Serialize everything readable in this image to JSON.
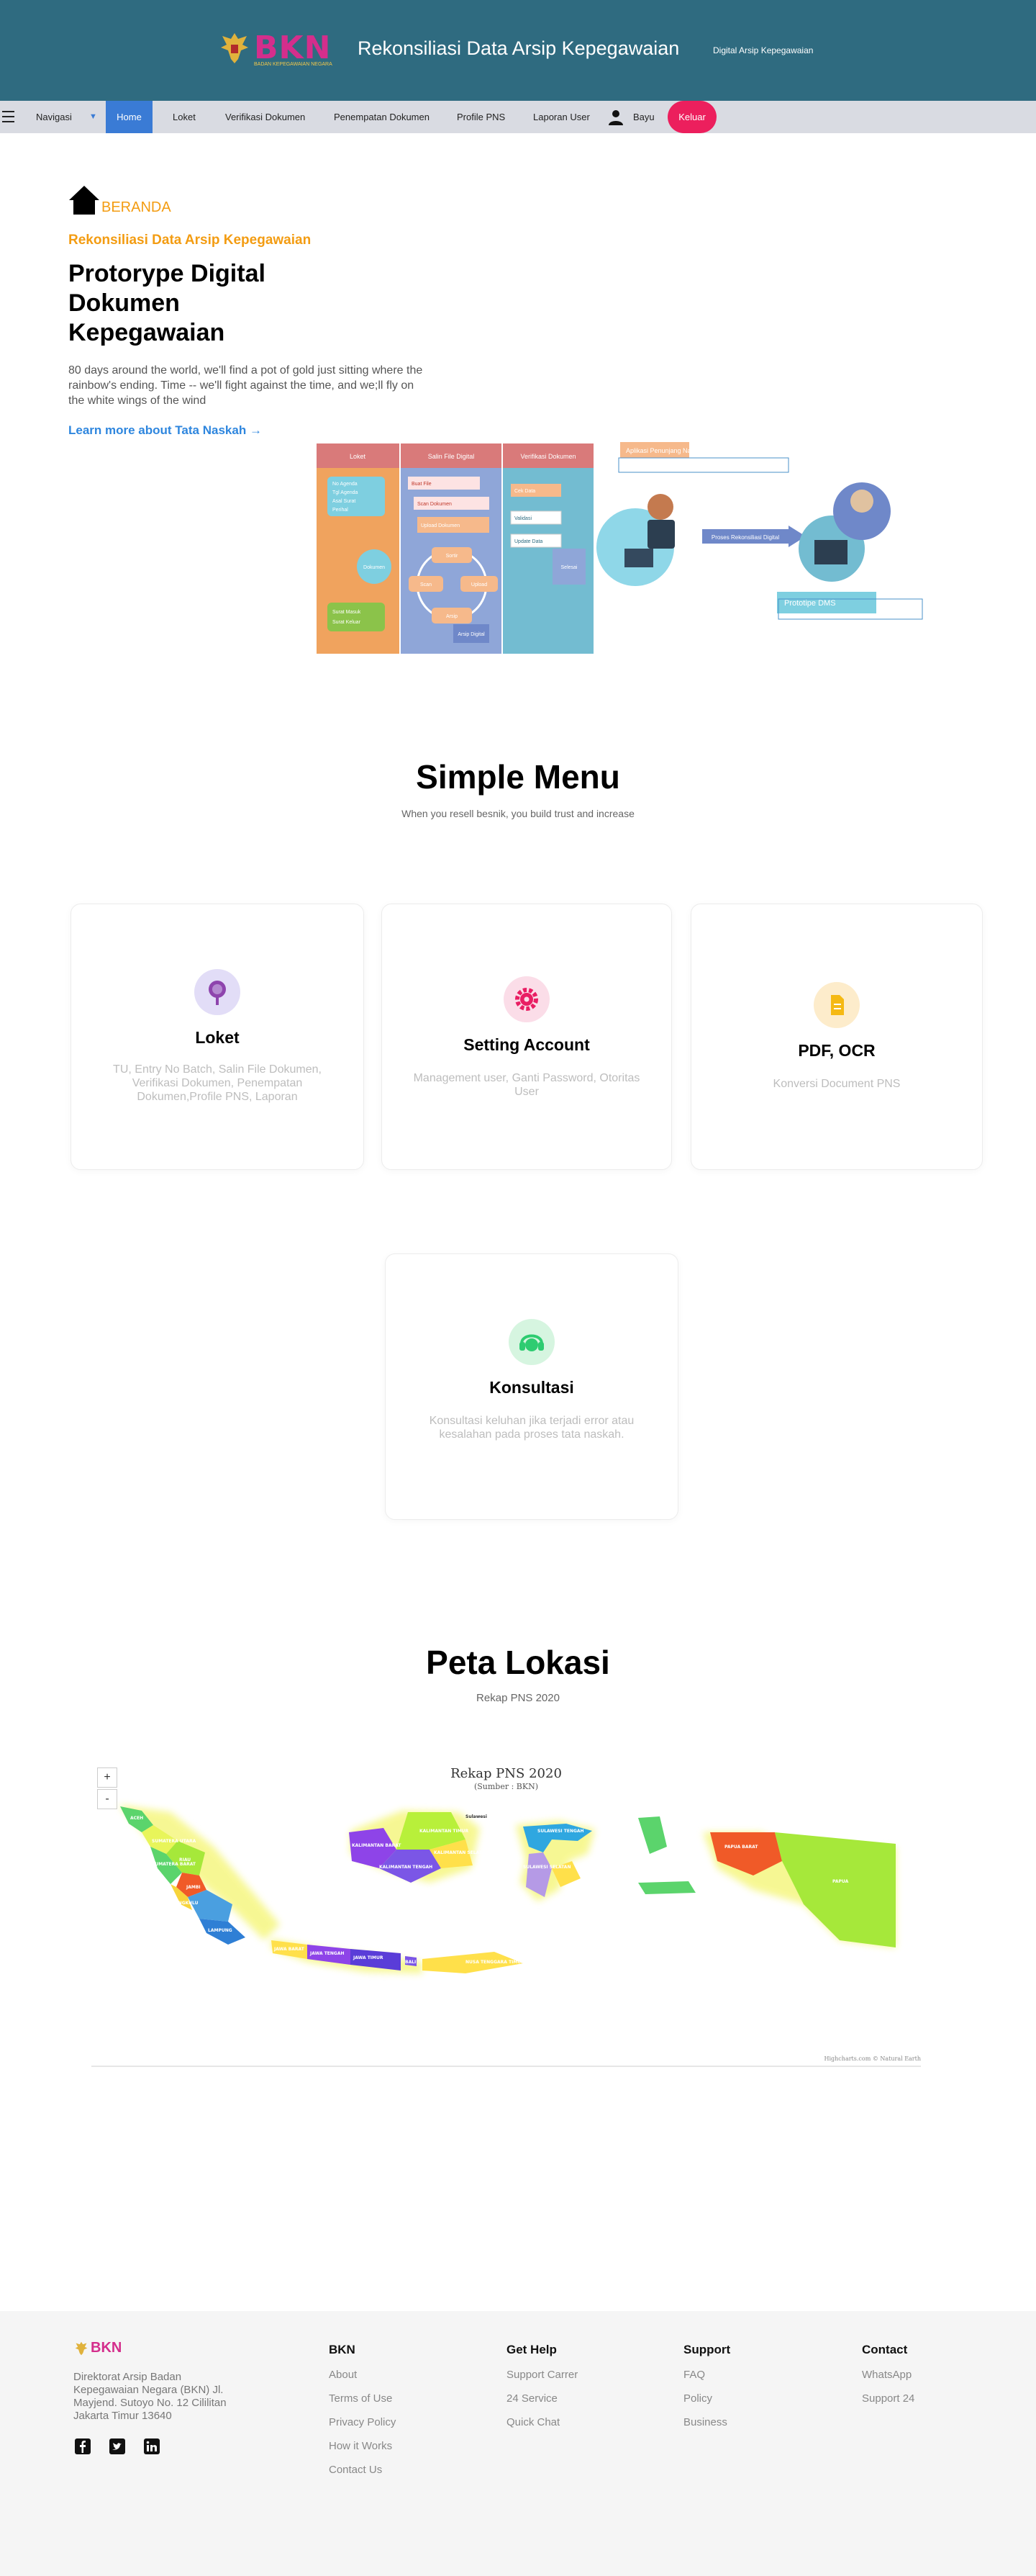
{
  "header": {
    "logo_text": "BKN",
    "logo_subtitle": "BADAN KEPEGAWAIAN NEGARA",
    "title": "Rekonsiliasi Data Arsip Kepegawaian",
    "subtitle": "Digital Arsip Kepegawaian"
  },
  "nav": {
    "navigasi": "Navigasi",
    "home": "Home",
    "loket": "Loket",
    "verifikasi": "Verifikasi Dokumen",
    "penempatan": "Penempatan Dokumen",
    "profile": "Profile PNS",
    "laporan": "Laporan User",
    "user": "Bayu",
    "keluar": "Keluar"
  },
  "hero": {
    "breadcrumb": "BERANDA",
    "kicker": "Rekonsiliasi Data Arsip Kepegawaian",
    "title": "Protorype Digital Dokumen Kepegawaian",
    "description": "80 days around the world, we'll find a pot of gold just sitting where the rainbow's ending. Time -- we'll fight against the time, and we;ll fly on the white wings of the wind",
    "link": "Learn more about Tata Naskah"
  },
  "diagram": {
    "col1": "Loket",
    "col2": "Salin File Digital",
    "col3": "Verifikasi Dokumen",
    "app_label": "Aplikasi Penunjang Nasional",
    "arrow_label": "Proses Rekonsiliasi Digital",
    "proto_label": "Prototipe DMS",
    "col1_items": [
      "No Agenda",
      "Tgl Agenda",
      "Asal Surat",
      "Perihal"
    ],
    "col1_circle": "Dokumen",
    "col1_bottom": [
      "Surat Masuk",
      "Surat Keluar"
    ],
    "col2_items": [
      "Buat File",
      "Scan Dokumen",
      "Upload Dokumen"
    ],
    "col2_cycle": [
      "Sortir",
      "Scan",
      "Upload",
      "Arsip",
      "Cek"
    ],
    "col2_footer": "Arsip Digital",
    "col3_items": [
      "Cek Data",
      "Validasi",
      "Update Data"
    ],
    "col3_badge": "Selesai"
  },
  "menu": {
    "title": "Simple Menu",
    "subtitle": "When you resell besnik, you build trust and increase",
    "cards": [
      {
        "title": "Loket",
        "desc": "TU, Entry No Batch, Salin File Dokumen, Verifikasi Dokumen, Penempatan Dokumen,Profile PNS, Laporan",
        "icon": "search-icon",
        "color": "#8e44ad"
      },
      {
        "title": "Setting Account",
        "desc": "Management user, Ganti Password, Otoritas User",
        "icon": "gear-icon",
        "color": "#e91e63"
      },
      {
        "title": "PDF, OCR",
        "desc": "Konversi Document PNS",
        "icon": "file-icon",
        "color": "#f5b914"
      },
      {
        "title": "Konsultasi",
        "desc": "Konsultasi keluhan jika terjadi error atau kesalahan pada proses tata naskah.",
        "icon": "headset-icon",
        "color": "#2ecc71"
      }
    ]
  },
  "map": {
    "title": "Peta Lokasi",
    "subtitle": "Rekap PNS 2020",
    "chart_title": "Rekap PNS 2020",
    "chart_subtitle": "(Sumber : BKN)",
    "credit": "Highcharts.com © Natural Earth",
    "zoom_in": "+",
    "zoom_out": "-",
    "labels": [
      "ACEH",
      "SUMATERA UTARA",
      "RIAU",
      "SUMATERA BARAT",
      "JAMBI",
      "BENGKULU",
      "LAMPUNG",
      "KALIMANTAN BARAT",
      "KALIMANTAN TENGAH",
      "KALIMANTAN TIMUR",
      "KALIMANTAN SELATAN",
      "SULAWESI TENGAH",
      "SULAWESI SELATAN",
      "JAWA BARAT",
      "JAWA TENGAH",
      "JAWA TIMUR",
      "BALI",
      "NUSA TENGGARA TIMUR",
      "PAPUA BARAT",
      "PAPUA",
      "Sulawesi"
    ]
  },
  "footer": {
    "logo_text": "BKN",
    "address": "Direktorat Arsip Badan Kepegawaian Negara (BKN) Jl. Mayjend. Sutoyo No. 12 Cililitan Jakarta Timur 13640",
    "cols": [
      {
        "title": "BKN",
        "links": [
          "About",
          "Terms of Use",
          "Privacy Policy",
          "How it Works",
          "Contact Us"
        ]
      },
      {
        "title": "Get Help",
        "links": [
          "Support Carrer",
          "24 Service",
          "Quick Chat"
        ]
      },
      {
        "title": "Support",
        "links": [
          "FAQ",
          "Policy",
          "Business"
        ]
      },
      {
        "title": "Contact",
        "links": [
          "WhatsApp",
          "Support 24"
        ]
      }
    ]
  }
}
